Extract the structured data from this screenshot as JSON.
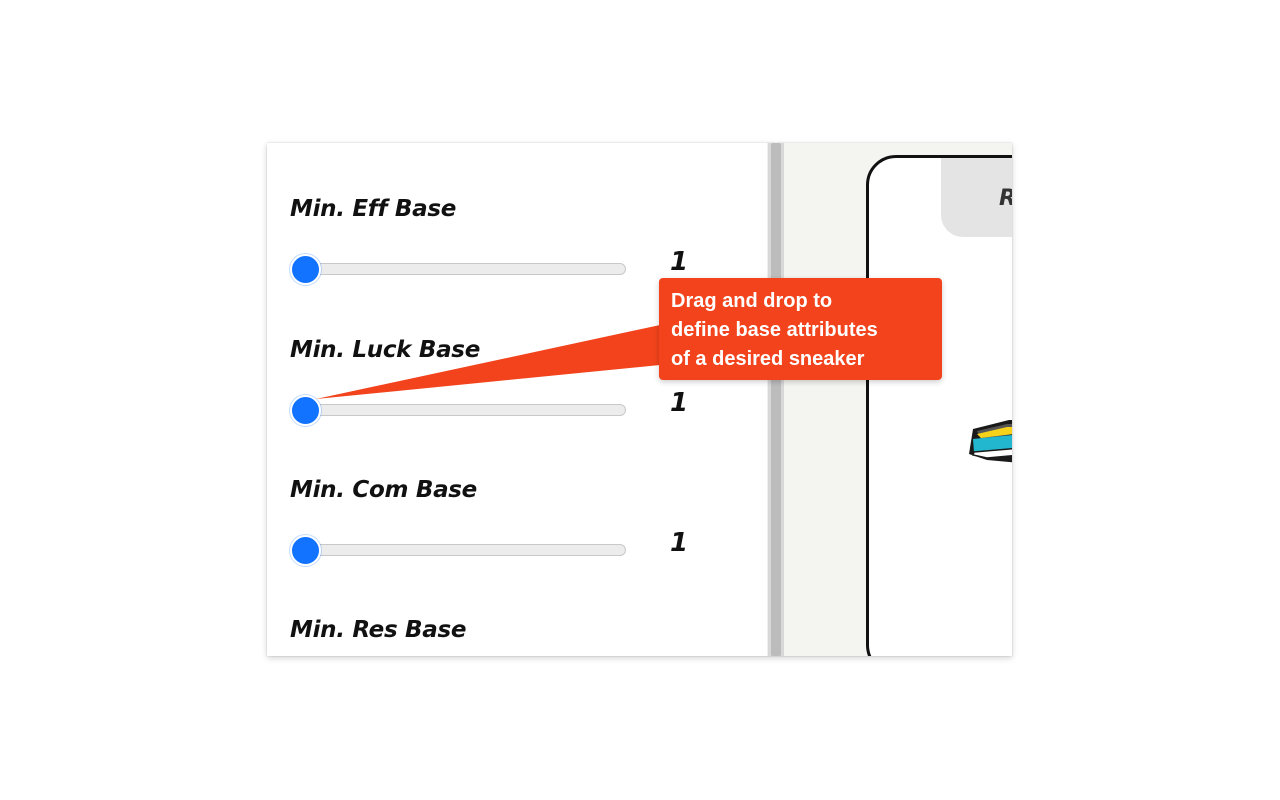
{
  "filters": [
    {
      "label": "Min. Eff Base",
      "value": "1",
      "level": 0
    },
    {
      "label": "Min. Luck Base",
      "value": "1",
      "level": 0
    },
    {
      "label": "Min. Com Base",
      "value": "1",
      "level": 0
    },
    {
      "label": "Min. Res Base",
      "value": "",
      "level": 0
    }
  ],
  "preview": {
    "tab_text": "R"
  },
  "tooltip": {
    "lines": [
      "Drag and drop to",
      "define base attributes",
      "of a desired sneaker"
    ]
  },
  "colors": {
    "accent": "#1173ff",
    "tooltip": "#f2431c"
  }
}
